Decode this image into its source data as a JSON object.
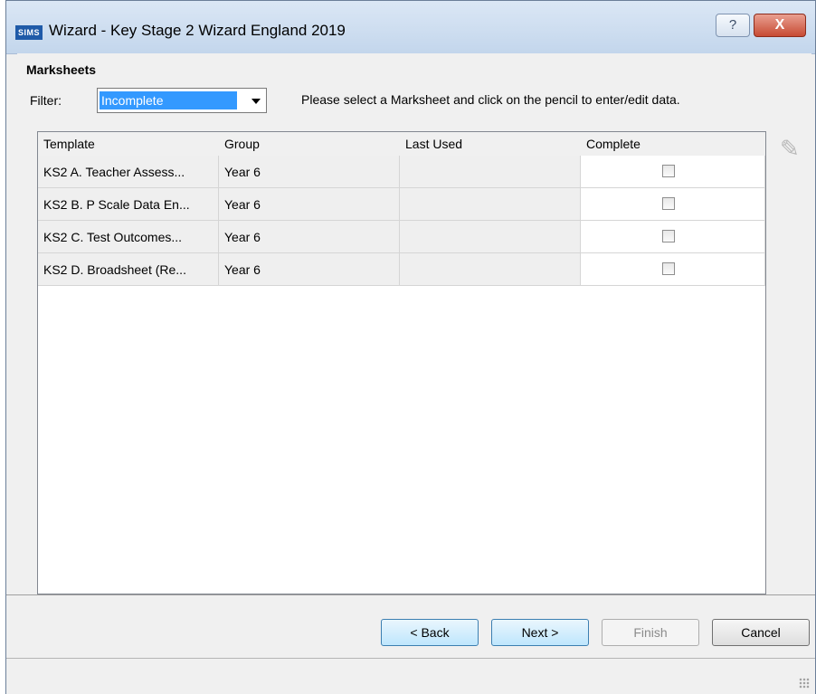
{
  "window": {
    "icon_text": "SIMS",
    "title": "Wizard - Key Stage 2 Wizard England 2019",
    "help_label": "?",
    "close_label": "X"
  },
  "marksheets": {
    "heading": "Marksheets",
    "filter_label": "Filter:",
    "filter_value": "Incomplete",
    "instruction": "Please select a Marksheet and click on the pencil to enter/edit data."
  },
  "grid": {
    "columns": [
      "Template",
      "Group",
      "Last Used",
      "Complete"
    ],
    "rows": [
      {
        "template": "KS2 A. Teacher Assess...",
        "group": "Year 6",
        "last_used": "",
        "complete": false
      },
      {
        "template": "KS2 B. P Scale Data En...",
        "group": "Year 6",
        "last_used": "",
        "complete": false
      },
      {
        "template": "KS2 C. Test Outcomes...",
        "group": "Year 6",
        "last_used": "",
        "complete": false
      },
      {
        "template": "KS2 D. Broadsheet (Re...",
        "group": "Year 6",
        "last_used": "",
        "complete": false
      }
    ]
  },
  "buttons": {
    "back": "< Back",
    "next": "Next >",
    "finish": "Finish",
    "cancel": "Cancel"
  }
}
